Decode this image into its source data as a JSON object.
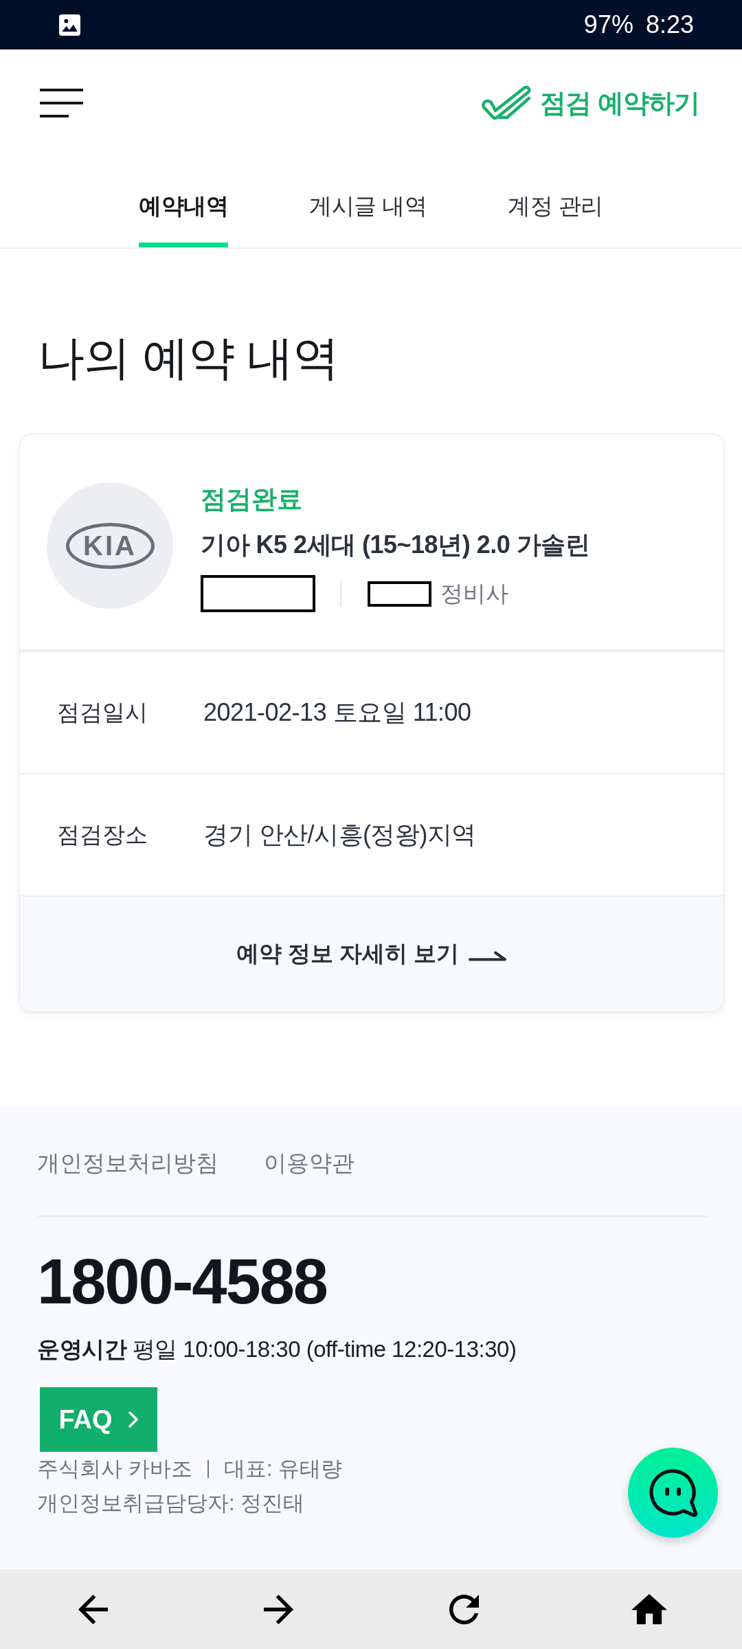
{
  "status_bar": {
    "battery": "97%",
    "time": "8:23"
  },
  "header": {
    "book_link": "점검 예약하기"
  },
  "tabs": [
    {
      "label": "예약내역",
      "selected": true
    },
    {
      "label": "게시글 내역",
      "selected": false
    },
    {
      "label": "계정 관리",
      "selected": false
    }
  ],
  "page_title": "나의 예약 내역",
  "reservations": [
    {
      "brand_logo": "KIA",
      "status": "점검완료",
      "car": "기아 K5 2세대 (15~18년) 2.0 가솔린",
      "mechanic_label": "정비사",
      "details": [
        {
          "label": "점검일시",
          "value": "2021-02-13 토요일 11:00"
        },
        {
          "label": "점검장소",
          "value": "경기 안산/시흥(정왕)지역"
        }
      ],
      "detail_button": "예약 정보 자세히 보기"
    }
  ],
  "footer": {
    "links": [
      "개인정보처리방침",
      "이용약관"
    ],
    "phone": "1800-4588",
    "hours": "**운영시간** 평일 10:00-18:30 (off-time 12:20-13:30)",
    "faq_button": "FAQ",
    "company_lines": [
      {
        "parts": [
          "주식회사 카바조",
          "대표: 유태량"
        ]
      },
      {
        "parts": [
          "개인정보취급담당자: 정진태"
        ]
      }
    ]
  }
}
